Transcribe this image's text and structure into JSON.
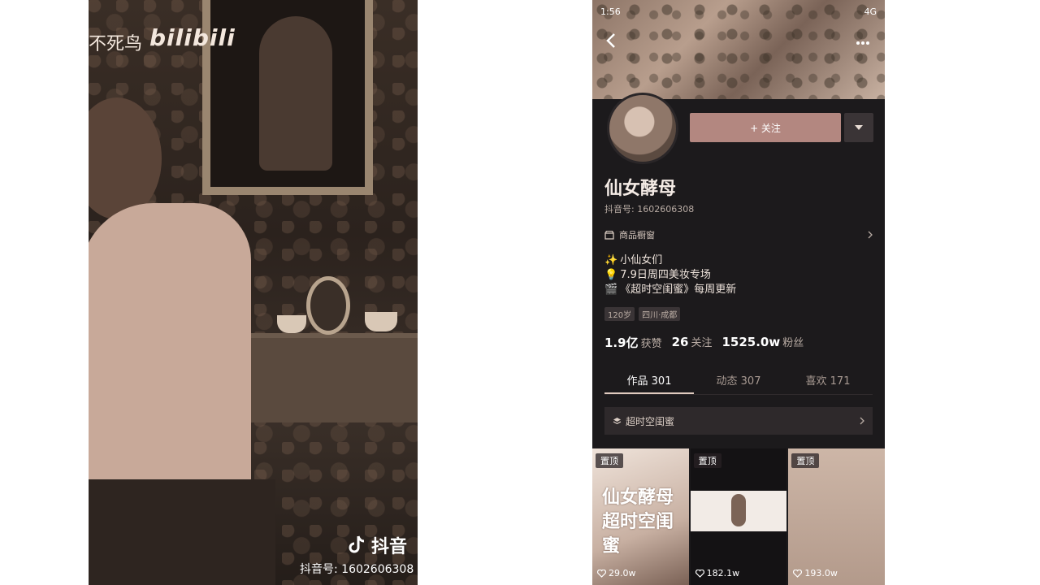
{
  "video": {
    "watermark_top": "不死鸟",
    "bilibili_logo": "bilibili",
    "douyin_logo": "抖音",
    "douyin_id": "抖音号: 1602606308"
  },
  "profile": {
    "status_time": "1:56",
    "status_network": "4G",
    "follow_button_text": "+ 关注",
    "name": "仙女酵母",
    "douyin_id": "抖音号: 1602606308",
    "shop_label": "商品橱窗",
    "bio": [
      "小仙女们",
      "7.9日周四美妆专场",
      "《超时空闺蜜》每周更新"
    ],
    "tags": [
      "120岁",
      "四川·成都"
    ],
    "stats": [
      {
        "value": "1.9亿",
        "label": "获赞"
      },
      {
        "value": "26",
        "label": "关注"
      },
      {
        "value": "1525.0w",
        "label": "粉丝"
      }
    ],
    "tabs": [
      "作品 301",
      "动态 307",
      "喜欢 171"
    ],
    "active_tab": 0,
    "collection_label": "超时空闺蜜",
    "posts": [
      {
        "pin": "置顶",
        "title": "仙女酵母 超时空闺蜜",
        "likes": "29.0w"
      },
      {
        "pin": "置顶",
        "likes": "182.1w"
      },
      {
        "pin": "置顶",
        "likes": "193.0w"
      }
    ]
  },
  "colors": {
    "follow_button": "#b38780",
    "profile_bg": "#1c1a1c"
  }
}
